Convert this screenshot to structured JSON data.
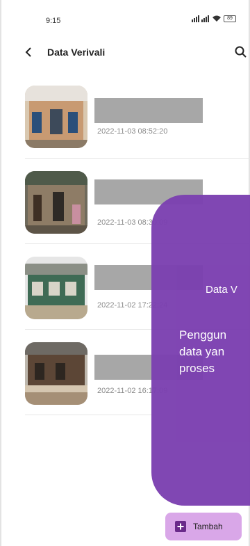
{
  "status": {
    "time": "9:15",
    "battery": "89"
  },
  "header": {
    "title": "Data Verivali"
  },
  "items": [
    {
      "date": "2022-11-03 08:52:20"
    },
    {
      "date": "2022-11-03 08:30:09"
    },
    {
      "date": "2022-11-02 17:22:24"
    },
    {
      "date": "2022-11-02 16:17:09"
    }
  ],
  "overlay": {
    "title": "Data V",
    "line1": "Penggun",
    "line2": "data yan",
    "line3": "proses"
  },
  "fab": {
    "label": "Tambah"
  },
  "colors": {
    "overlay": "#7b3fb0",
    "fab": "#d9a7e8",
    "redaction": "#a7a7a7"
  }
}
